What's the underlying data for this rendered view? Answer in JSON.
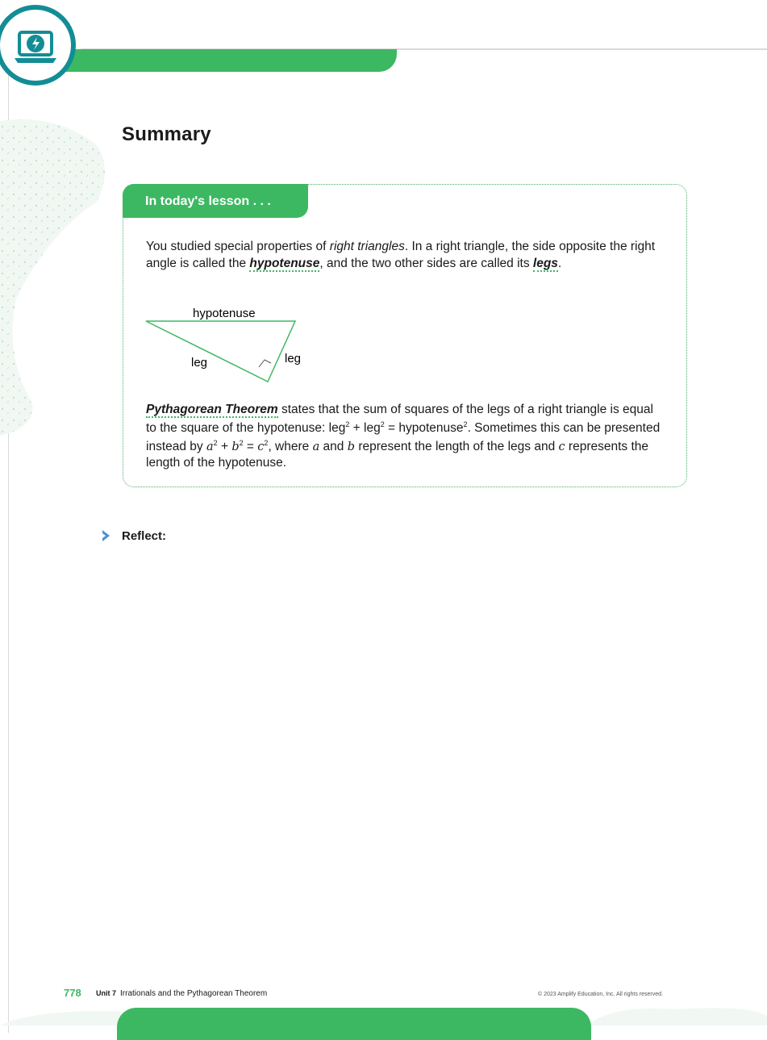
{
  "header": {
    "icon": "laptop-lightning-icon",
    "accent": "#3db862",
    "badge_ring": "#138d95"
  },
  "summary": {
    "title": "Summary",
    "tab_label": "In today's lesson . . .",
    "para1": {
      "a": "You studied special properties of ",
      "b": "right triangles",
      "c": ". In a right triangle, the side opposite the right angle is called the ",
      "d": "hypotenuse",
      "e": ", and the two other sides are called its ",
      "f": "legs",
      "g": "."
    },
    "diagram": {
      "hypotenuse_label": "hypotenuse",
      "leg_label_left": "leg",
      "leg_label_right": "leg"
    },
    "para2": {
      "a": "Pythagorean Theorem",
      "b": " states that the sum of squares of the legs of a right triangle is equal to the square of the hypotenuse:  ",
      "leg": "leg",
      "sq": "2",
      "plus": " + ",
      "eq": " = ",
      "hyp": "hypotenuse",
      "c": ". Sometimes this can be presented instead by ",
      "a_var": "a",
      "b_var": "b",
      "c_var": "c",
      "d": ", where ",
      "e": " and ",
      "f": " represent the length of the legs and ",
      "g": " represents the length of the hypotenuse."
    }
  },
  "reflect": {
    "label": "Reflect:"
  },
  "footer": {
    "page_number": "778",
    "unit": "Unit 7",
    "unit_title": "Irrationals and the Pythagorean Theorem",
    "copyright": "© 2023 Amplify Education, Inc. All rights reserved."
  }
}
